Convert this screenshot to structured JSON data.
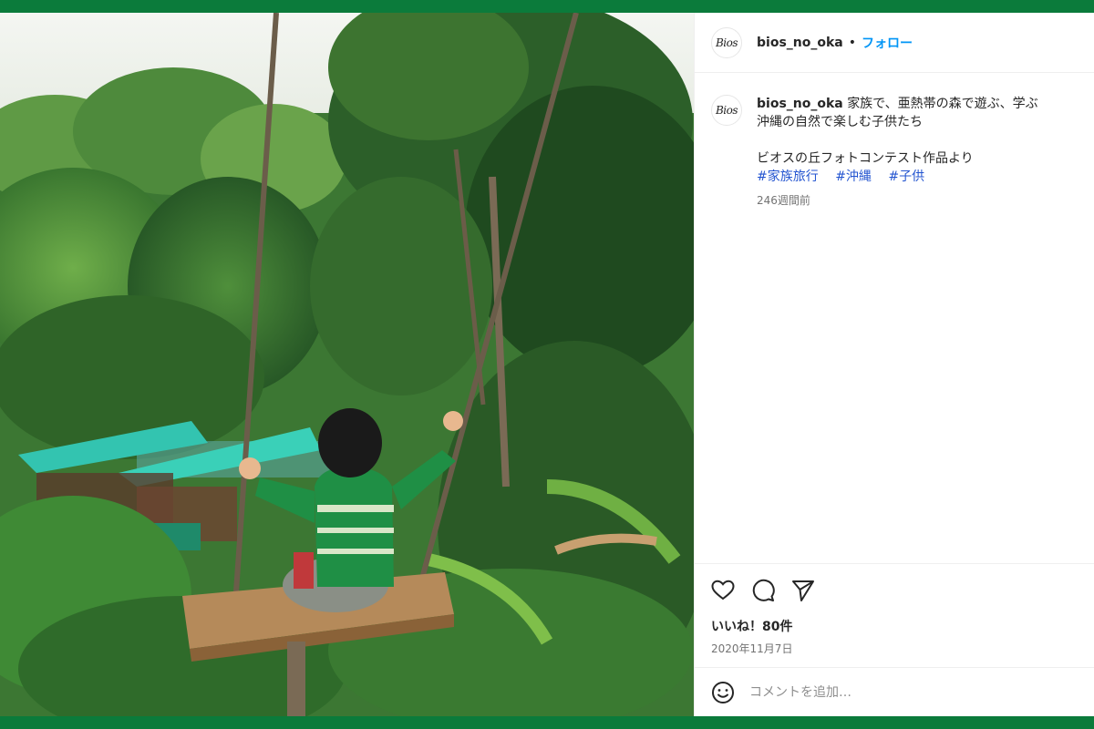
{
  "post": {
    "username": "bios_no_oka",
    "avatar_text": "Bios",
    "follow_label": "フォロー",
    "dot": "•",
    "caption": {
      "line1": "家族で、亜熱帯の森で遊ぶ、学ぶ",
      "line2": "沖縄の自然で楽しむ子供たち",
      "line3": "ビオスの丘フォトコンテスト作品より",
      "hashtags": [
        "#家族旅行",
        "#沖縄",
        "#子供"
      ]
    },
    "time_ago": "246週間前",
    "likes": "いいね！80件",
    "date": "2020年11月7日",
    "comment_placeholder": "コメントを追加…"
  },
  "icons": {
    "like": "heart-icon",
    "comment": "comment-bubble-icon",
    "share": "send-icon",
    "emoji": "smiley-icon"
  },
  "colors": {
    "frame": "#0b7b3b",
    "follow": "#0095f6",
    "hashtag": "#2455d0"
  }
}
